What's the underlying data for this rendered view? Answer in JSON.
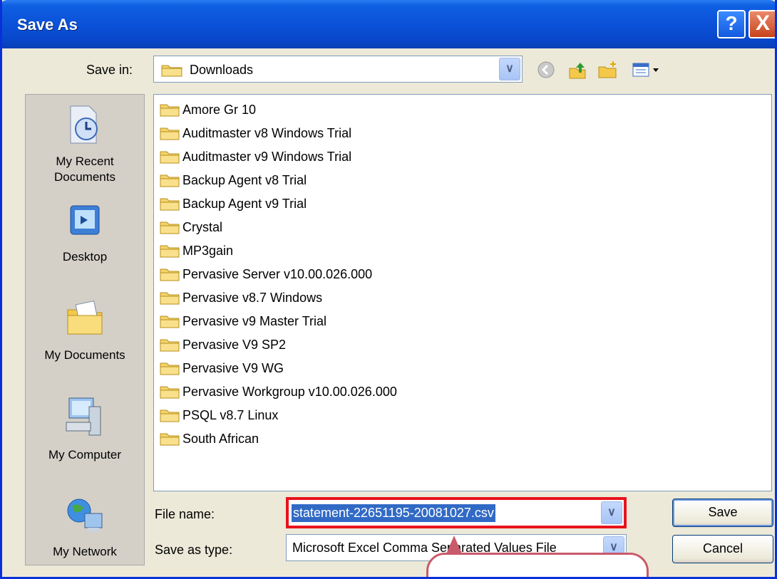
{
  "window": {
    "title": "Save As",
    "help_glyph": "?",
    "close_glyph": "X"
  },
  "save_in": {
    "label": "Save in:",
    "value": "Downloads"
  },
  "toolbar_icons": [
    "back-icon",
    "up-folder-icon",
    "new-folder-icon",
    "views-menu-icon"
  ],
  "places": [
    {
      "icon": "recent-documents-icon",
      "label": "My Recent\nDocuments"
    },
    {
      "icon": "desktop-icon",
      "label": "Desktop"
    },
    {
      "icon": "my-documents-icon",
      "label": "My Documents"
    },
    {
      "icon": "my-computer-icon",
      "label": "My Computer"
    },
    {
      "icon": "my-network-icon",
      "label": "My Network"
    }
  ],
  "files": [
    "Amore Gr 10",
    "Auditmaster v8 Windows Trial",
    "Auditmaster v9 Windows Trial",
    "Backup Agent v8 Trial",
    "Backup Agent v9 Trial",
    "Crystal",
    "MP3gain",
    "Pervasive Server v10.00.026.000",
    "Pervasive v8.7 Windows",
    "Pervasive v9 Master Trial",
    "Pervasive V9 SP2",
    "Pervasive V9 WG",
    "Pervasive Workgroup v10.00.026.000",
    "PSQL v8.7 Linux",
    "South African"
  ],
  "file_name": {
    "label": "File name:",
    "value": "statement-22651195-20081027.csv"
  },
  "save_as_type": {
    "label": "Save as type:",
    "value": "Microsoft Excel Comma Separated Values File"
  },
  "buttons": {
    "save": "Save",
    "cancel": "Cancel"
  },
  "colors": {
    "title_bar": "#0a50d6",
    "highlight_box": "#e8131c",
    "selection": "#316ac5"
  }
}
